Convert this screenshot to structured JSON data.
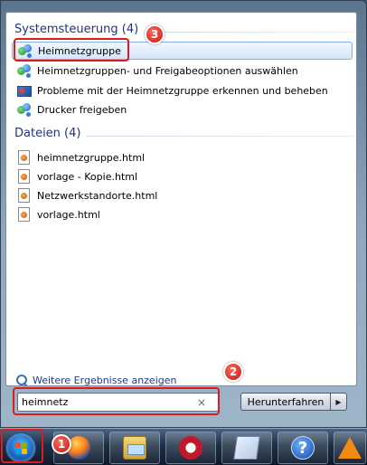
{
  "start_menu": {
    "groups": [
      {
        "header": "Systemsteuerung (4)",
        "items": [
          {
            "label": "Heimnetzgruppe",
            "icon": "homegroup-icon",
            "selected": true
          },
          {
            "label": "Heimnetzgruppen- und Freigabeoptionen auswählen",
            "icon": "homegroup-icon"
          },
          {
            "label": "Probleme mit der Heimnetzgruppe erkennen und beheben",
            "icon": "troubleshoot-icon"
          },
          {
            "label": "Drucker freigeben",
            "icon": "homegroup-icon"
          }
        ]
      },
      {
        "header": "Dateien (4)",
        "items": [
          {
            "label": "heimnetzgruppe.html",
            "icon": "html-file-icon"
          },
          {
            "label": "vorlage - Kopie.html",
            "icon": "html-file-icon"
          },
          {
            "label": "Netzwerkstandorte.html",
            "icon": "html-file-icon"
          },
          {
            "label": "vorlage.html",
            "icon": "html-file-icon"
          }
        ]
      }
    ],
    "more_results": "Weitere Ergebnisse anzeigen",
    "search": {
      "value": "heimnetz",
      "clear_glyph": "×"
    },
    "shutdown_label": "Herunterfahren",
    "shutdown_arrow_glyph": "▶"
  },
  "callouts": [
    "1",
    "2",
    "3"
  ],
  "taskbar": {
    "icons": [
      "windows-start-icon",
      "firefox-icon",
      "file-explorer-icon",
      "media-player-icon",
      "notes-icon",
      "help-icon",
      "vlc-icon"
    ],
    "help_glyph": "?"
  },
  "colors": {
    "group_header": "#1e3287",
    "selection_fill": "#d5e6fb",
    "selection_border": "#86b0e3",
    "callout_red": "#e01b1b",
    "link": "#1e3b8a"
  }
}
